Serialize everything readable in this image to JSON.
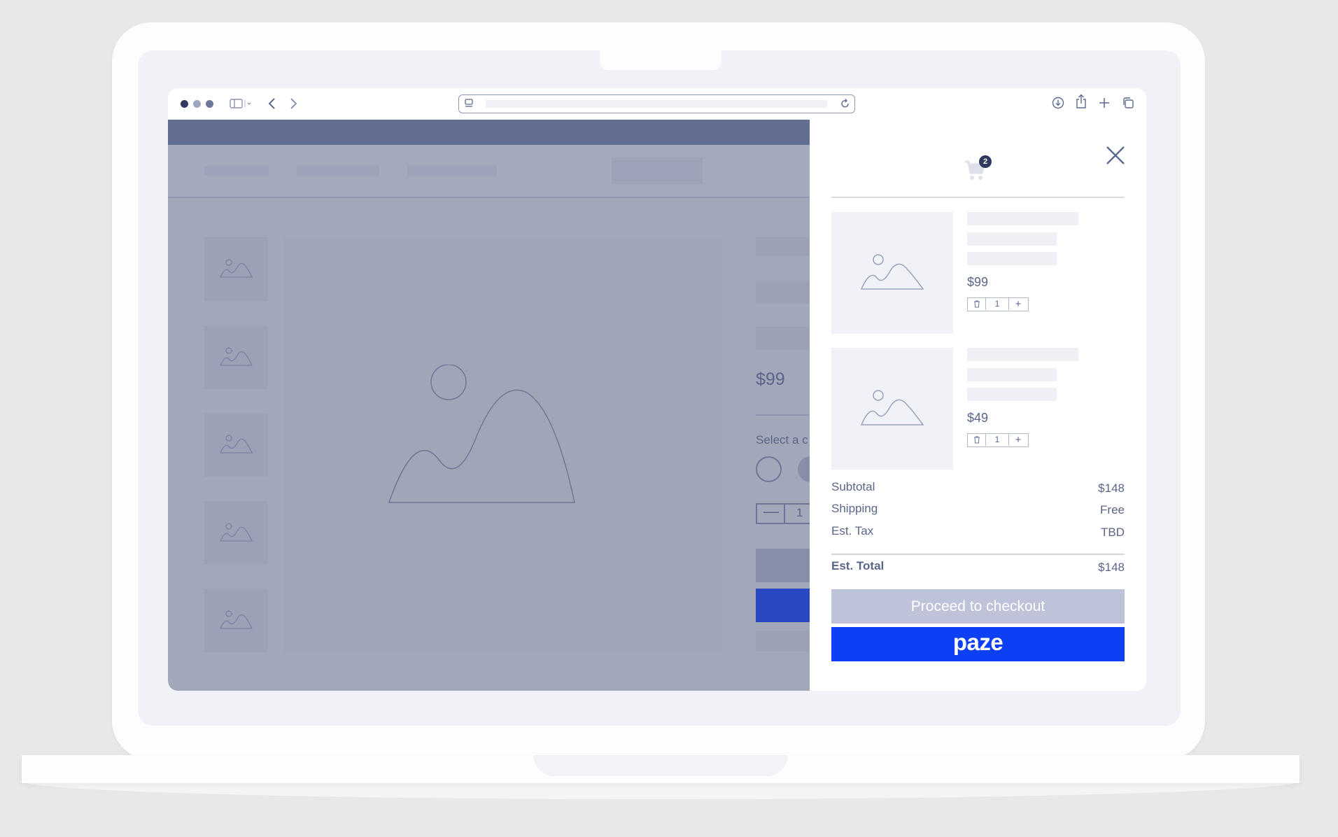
{
  "page": {
    "price": "$99",
    "select_label": "Select a c",
    "quantity": "1"
  },
  "cart": {
    "badge_count": "2",
    "items": [
      {
        "price": "$99",
        "quantity": "1"
      },
      {
        "price": "$49",
        "quantity": "1"
      }
    ],
    "summary": {
      "subtotal_label": "Subtotal",
      "subtotal_value": "$148",
      "shipping_label": "Shipping",
      "shipping_value": "Free",
      "tax_label": "Est. Tax",
      "tax_value": "TBD",
      "total_label": "Est. Total",
      "total_value": "$148"
    },
    "checkout_label": "Proceed to checkout",
    "paze_label": "paze"
  },
  "colors": {
    "paze_blue": "#0d3ff5",
    "checkout_disabled": "#bfc3d9",
    "text": "#5b6588"
  }
}
